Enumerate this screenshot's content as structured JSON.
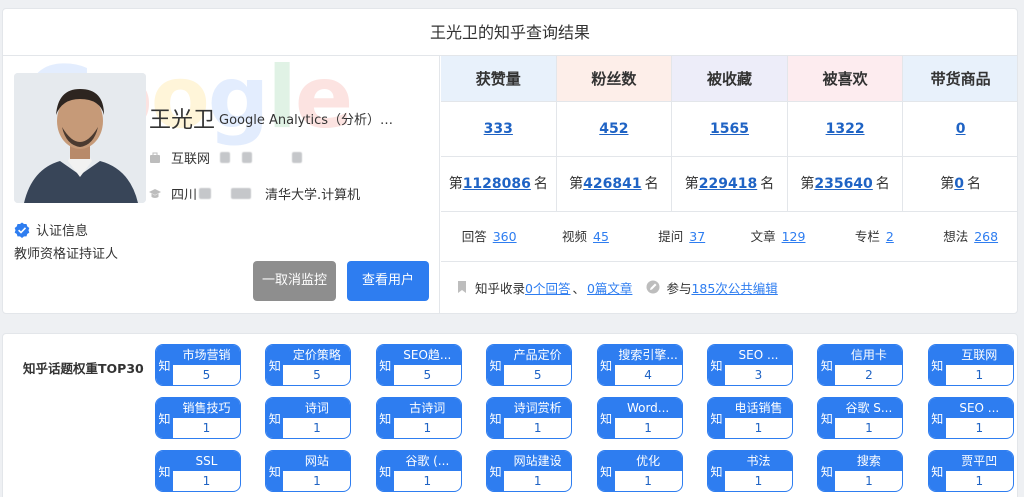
{
  "header": {
    "title": "王光卫的知乎查询结果"
  },
  "profile": {
    "name": "王光卫",
    "tagline": "Google Analytics（分析）…",
    "industry": "互联网",
    "location": "四川",
    "education": "清华大学.计算机",
    "verify_label": "认证信息",
    "verify_desc": "教师资格证持证人",
    "unfollow_button": "一取消监控",
    "view_button": "查看用户"
  },
  "stats": {
    "columns": [
      {
        "label": "获赞量",
        "value": "333",
        "rank_prefix": "第",
        "rank": "1128086",
        "rank_suffix": "名",
        "color": "#e8f1fb"
      },
      {
        "label": "粉丝数",
        "value": "452",
        "rank_prefix": "第",
        "rank": "426841",
        "rank_suffix": "名",
        "color": "#fdeee9"
      },
      {
        "label": "被收藏",
        "value": "1565",
        "rank_prefix": "第",
        "rank": "229418",
        "rank_suffix": "名",
        "color": "#ededf9"
      },
      {
        "label": "被喜欢",
        "value": "1322",
        "rank_prefix": "第",
        "rank": "235640",
        "rank_suffix": "名",
        "color": "#fdecef"
      },
      {
        "label": "带货商品",
        "value": "0",
        "rank_prefix": "第",
        "rank": "0",
        "rank_suffix": "名",
        "color": "#e8f1fb"
      }
    ]
  },
  "counts": [
    {
      "label": "回答",
      "value": "360"
    },
    {
      "label": "视频",
      "value": "45"
    },
    {
      "label": "提问",
      "value": "37"
    },
    {
      "label": "文章",
      "value": "129"
    },
    {
      "label": "专栏",
      "value": "2"
    },
    {
      "label": "想法",
      "value": "268"
    }
  ],
  "contrib": {
    "collected_label": "知乎收录",
    "answers_link": "0个回答",
    "sep": "、",
    "articles_link": "0篇文章",
    "participate_label": "参与",
    "edits_link": "185次公共编辑"
  },
  "topics": {
    "title": "知乎话题权重TOP30",
    "badge": "知",
    "items": [
      {
        "name": "市场营销",
        "count": "5"
      },
      {
        "name": "定价策略",
        "count": "5"
      },
      {
        "name": "SEO趋...",
        "count": "5"
      },
      {
        "name": "产品定价",
        "count": "5"
      },
      {
        "name": "搜索引擎...",
        "count": "4"
      },
      {
        "name": "SEO ...",
        "count": "3"
      },
      {
        "name": "信用卡",
        "count": "2"
      },
      {
        "name": "互联网",
        "count": "1"
      },
      {
        "name": "销售技巧",
        "count": "1"
      },
      {
        "name": "诗词",
        "count": "1"
      },
      {
        "name": "古诗词",
        "count": "1"
      },
      {
        "name": "诗词赏析",
        "count": "1"
      },
      {
        "name": "Word...",
        "count": "1"
      },
      {
        "name": "电话销售",
        "count": "1"
      },
      {
        "name": "谷歌 S...",
        "count": "1"
      },
      {
        "name": "SEO ...",
        "count": "1"
      },
      {
        "name": "SSL",
        "count": "1"
      },
      {
        "name": "网站",
        "count": "1"
      },
      {
        "name": "谷歌 (...",
        "count": "1"
      },
      {
        "name": "网站建设",
        "count": "1"
      },
      {
        "name": "优化",
        "count": "1"
      },
      {
        "name": "书法",
        "count": "1"
      },
      {
        "name": "搜索",
        "count": "1"
      },
      {
        "name": "贾平凹",
        "count": "1"
      }
    ]
  }
}
